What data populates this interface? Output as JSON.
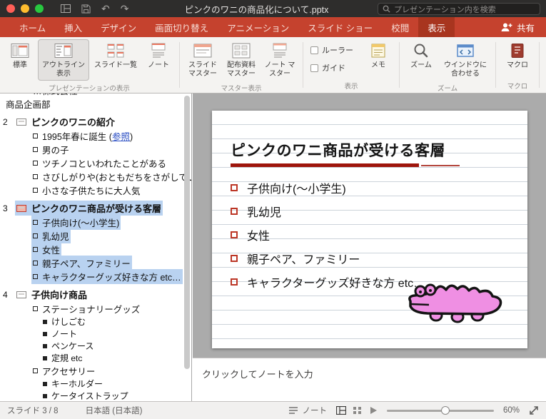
{
  "colors": {
    "ribbon_red": "#c5422e",
    "active_tab_red": "#a8351f",
    "selection_blue": "#b9d2f0",
    "slide_rule_red": "#9e150c",
    "bullet_red": "#bc3626",
    "croc_pink": "#ef8fe3",
    "link_blue": "#2e51c4"
  },
  "titlebar": {
    "title": "ピンクのワニの商品化について.pptx",
    "search_placeholder": "プレゼンテーション内を検索"
  },
  "tabbar": {
    "tabs": [
      "ホーム",
      "挿入",
      "デザイン",
      "画面切り替え",
      "アニメーション",
      "スライド ショー",
      "校閲",
      "表示"
    ],
    "active_index": 7,
    "share_label": "共有"
  },
  "ribbon": {
    "presentation_views": {
      "label": "プレゼンテーションの表示",
      "normal": "標準",
      "outline": "アウトライン表示",
      "slide_sorter": "スライド一覧",
      "notes_page": "ノート"
    },
    "master_views": {
      "label": "マスター表示",
      "slide_master": "スライド マスター",
      "handout_master": "配布資料 マスター",
      "notes_master": "ノート マスター"
    },
    "show": {
      "label": "表示",
      "ruler": "ルーラー",
      "guides": "ガイド",
      "ruler_checked": false,
      "guides_checked": false,
      "notes": "メモ"
    },
    "zoom": {
      "label": "ズーム",
      "zoom": "ズーム",
      "fit_window": "ウインドウに合わせる"
    },
    "macros": {
      "label": "マクロ",
      "macro": "マクロ"
    }
  },
  "outline": {
    "items": [
      {
        "level": 1,
        "text": "…株式会社",
        "clipped": true
      },
      {
        "level": 1,
        "text": "商品企画部",
        "flush": true
      },
      {
        "num": "2",
        "type": "title",
        "text": "ピンクのワニの紹介"
      },
      {
        "level": 1,
        "bullet": "hollow",
        "pre": "1995年春に誕生 (",
        "link": "参照",
        "post": ")"
      },
      {
        "level": 1,
        "bullet": "hollow",
        "text": "男の子"
      },
      {
        "level": 1,
        "bullet": "hollow",
        "text": "ツチノコといわれたことがある"
      },
      {
        "level": 1,
        "bullet": "hollow",
        "text": "さびしがりや(おともだちをさがしている)"
      },
      {
        "level": 1,
        "bullet": "hollow",
        "text": "小さな子供たちに大人気"
      },
      {
        "num": "3",
        "type": "title",
        "current": true,
        "selected": true,
        "text": "ピンクのワニ商品が受ける客層"
      },
      {
        "level": 1,
        "bullet": "hollow",
        "selected": true,
        "text": "子供向け(〜小学生)"
      },
      {
        "level": 1,
        "bullet": "hollow",
        "selected": true,
        "text": "乳幼児"
      },
      {
        "level": 1,
        "bullet": "hollow",
        "selected": true,
        "text": "女性"
      },
      {
        "level": 1,
        "bullet": "hollow",
        "selected": true,
        "text": "親子ペア、ファミリー"
      },
      {
        "level": 1,
        "bullet": "hollow",
        "selected": true,
        "text": "キャラクターグッズ好きな方 etc…"
      },
      {
        "num": "4",
        "type": "title",
        "text": "子供向け商品"
      },
      {
        "level": 1,
        "bullet": "hollow",
        "text": "ステーショナリーグッズ"
      },
      {
        "level": 2,
        "bullet": "filled",
        "text": "けしごむ"
      },
      {
        "level": 2,
        "bullet": "filled",
        "text": "ノート"
      },
      {
        "level": 2,
        "bullet": "filled",
        "text": "ペンケース"
      },
      {
        "level": 2,
        "bullet": "filled",
        "text": "定規 etc"
      },
      {
        "level": 1,
        "bullet": "hollow",
        "text": "アクセサリー"
      },
      {
        "level": 2,
        "bullet": "filled",
        "text": "キーホルダー"
      },
      {
        "level": 2,
        "bullet": "filled",
        "text": "ケータイストラップ"
      }
    ]
  },
  "slide": {
    "title": "ピンクのワニ商品が受ける客層",
    "bullets": [
      "子供向け(〜小学生)",
      "乳幼児",
      "女性",
      "親子ペア、ファミリー",
      "キャラクターグッズ好きな方 etc…"
    ]
  },
  "notes": {
    "placeholder": "クリックしてノートを入力"
  },
  "statusbar": {
    "slide_position": "スライド 3 / 8",
    "language": "日本語 (日本語)",
    "notes_toggle": "ノート",
    "zoom_percent": "60%"
  },
  "icons": {
    "titlebar": [
      "close",
      "minimize",
      "zoom-window",
      "view-switcher",
      "save",
      "undo",
      "redo",
      "search"
    ],
    "ribbon": [
      "normal-view",
      "outline-view",
      "slide-sorter",
      "notes-page",
      "slide-master",
      "handout-master",
      "notes-master",
      "ruler-checkbox",
      "guides-checkbox",
      "memo-note",
      "zoom-magnifier",
      "fit-window",
      "macro"
    ],
    "statusbar": [
      "notes-lines",
      "normal-view",
      "slide-sorter",
      "slideshow-play",
      "zoom-slider",
      "expand-fit"
    ],
    "share": "person-plus"
  }
}
